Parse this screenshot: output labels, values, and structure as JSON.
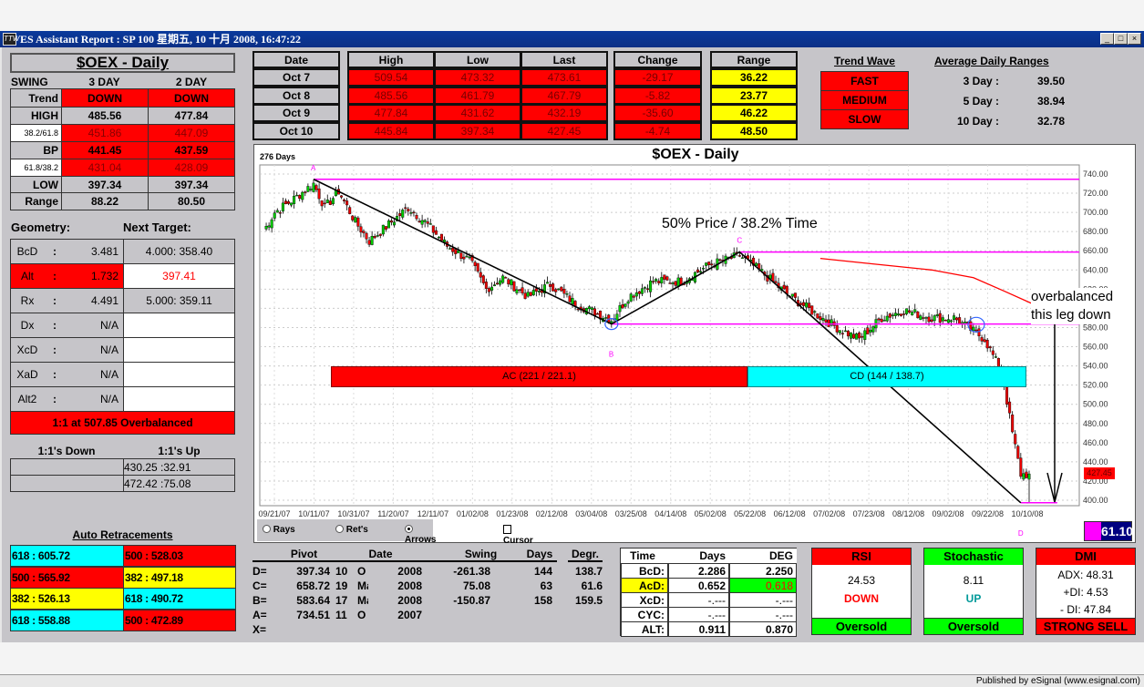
{
  "window": {
    "title": "ES Assistant Report : SP 100  星期五, 10 十月 2008, 16:47:22",
    "icon": "TTW",
    "controls": [
      "_",
      "□",
      "×"
    ]
  },
  "status_bar": "Published by eSignal (www.esignal.com)",
  "left": {
    "title": "$OEX - Daily",
    "swing_header": [
      "SWING",
      "3 DAY",
      "2 DAY"
    ],
    "swing_rows": [
      {
        "label": "Trend",
        "d3": "DOWN",
        "d2": "DOWN"
      },
      {
        "label": "HIGH",
        "d3": "485.56",
        "d2": "477.84"
      },
      {
        "label": "38.2/61.8",
        "d3": "451.86",
        "d2": "447.09"
      },
      {
        "label": "BP",
        "d3": "441.45",
        "d2": "437.59"
      },
      {
        "label": "61.8/38.2",
        "d3": "431.04",
        "d2": "428.09"
      },
      {
        "label": "LOW",
        "d3": "397.34",
        "d2": "397.34"
      },
      {
        "label": "Range",
        "d3": "88.22",
        "d2": "80.50"
      }
    ],
    "geometry_label": "Geometry:",
    "next_target_label": "Next Target:",
    "geometry": [
      {
        "name": "BcD",
        "sep": ":",
        "value": "3.481",
        "target": "4.000: 358.40"
      },
      {
        "name": "Alt",
        "sep": ":",
        "value": "1.732",
        "target": "397.41"
      },
      {
        "name": "Rx",
        "sep": ":",
        "value": "4.491",
        "target": "5.000: 359.11"
      },
      {
        "name": "Dx",
        "sep": ":",
        "value": "N/A",
        "target": ""
      },
      {
        "name": "XcD",
        "sep": ":",
        "value": "N/A",
        "target": ""
      },
      {
        "name": "XaD",
        "sep": ":",
        "value": "N/A",
        "target": ""
      },
      {
        "name": "Alt2",
        "sep": ":",
        "value": "N/A",
        "target": ""
      }
    ],
    "overbalanced": "1:1 at 507.85 Overbalanced",
    "ones_down_label": "1:1's Down",
    "ones_up_label": "1:1's Up",
    "ones": [
      {
        "down": "",
        "up": "430.25 :32.91"
      },
      {
        "down": "",
        "up": "472.42 :75.08"
      }
    ],
    "auto_retracements_label": "Auto Retracements",
    "retracements": [
      [
        {
          "text": "618 : 605.72",
          "color": "#00ffff"
        },
        {
          "text": "500 : 528.03",
          "color": "#ff0000"
        }
      ],
      [
        {
          "text": "500 : 565.92",
          "color": "#ff0000"
        },
        {
          "text": "382 : 497.18",
          "color": "#ffff00"
        }
      ],
      [
        {
          "text": "382 : 526.13",
          "color": "#ffff00"
        },
        {
          "text": "618 : 490.72",
          "color": "#00ffff"
        }
      ],
      [
        {
          "text": "618 : 558.88",
          "color": "#00ffff"
        },
        {
          "text": "500 : 472.89",
          "color": "#ff0000"
        }
      ]
    ]
  },
  "daily": {
    "headers": [
      "Date",
      "High",
      "Low",
      "Last",
      "Change",
      "Range"
    ],
    "rows": [
      {
        "date": "Oct 7",
        "high": "509.54",
        "low": "473.32",
        "last": "473.61",
        "change": "-29.17",
        "range": "36.22"
      },
      {
        "date": "Oct 8",
        "high": "485.56",
        "low": "461.79",
        "last": "467.79",
        "change": "-5.82",
        "range": "23.77"
      },
      {
        "date": "Oct 9",
        "high": "477.84",
        "low": "431.62",
        "last": "432.19",
        "change": "-35.60",
        "range": "46.22"
      },
      {
        "date": "Oct 10",
        "high": "445.84",
        "low": "397.34",
        "last": "427.45",
        "change": "-4.74",
        "range": "48.50"
      }
    ]
  },
  "trend_wave": {
    "title": "Trend Wave",
    "items": [
      "FAST",
      "MEDIUM",
      "SLOW"
    ]
  },
  "avg_ranges": {
    "title": "Average Daily Ranges",
    "items": [
      {
        "label": "3 Day :",
        "value": "39.50"
      },
      {
        "label": "5 Day :",
        "value": "38.94"
      },
      {
        "label": "10 Day :",
        "value": "32.78"
      }
    ]
  },
  "chart": {
    "title": "$OEX - Daily",
    "days_label": "276 Days",
    "annotation": "50% Price / 38.2% Time",
    "overbalanced_note": [
      "overbalanced",
      "this leg down"
    ],
    "ac_bar": "AC (221 / 221.1)",
    "cd_bar": "CD (144 / 138.7)",
    "last_price": "427.45",
    "readout": "61.10",
    "options": [
      {
        "label": "Rays",
        "type": "radio",
        "checked": false
      },
      {
        "label": "Ret's",
        "type": "radio",
        "checked": false
      },
      {
        "label": "Arrows",
        "type": "radio",
        "checked": true
      },
      {
        "label": "Cursor",
        "type": "checkbox",
        "checked": false
      }
    ]
  },
  "chart_data": {
    "type": "candlestick",
    "title": "$OEX - Daily",
    "ylim": [
      390,
      745
    ],
    "yticks": [
      "740.00",
      "720.00",
      "700.00",
      "680.00",
      "660.00",
      "640.00",
      "620.00",
      "600.00",
      "580.00",
      "560.00",
      "540.00",
      "520.00",
      "500.00",
      "480.00",
      "460.00",
      "440.00",
      "420.00",
      "400.00"
    ],
    "xticks": [
      "09/21/07",
      "10/11/07",
      "10/31/07",
      "11/20/07",
      "12/11/07",
      "01/02/08",
      "01/23/08",
      "02/12/08",
      "03/04/08",
      "03/25/08",
      "04/14/08",
      "05/02/08",
      "05/22/08",
      "06/12/08",
      "07/02/08",
      "07/23/08",
      "08/12/08",
      "09/02/08",
      "09/22/08",
      "10/10/08"
    ],
    "days": 276,
    "close_anchors": [
      [
        0,
        680
      ],
      [
        4,
        700
      ],
      [
        10,
        712
      ],
      [
        18,
        730
      ],
      [
        22,
        705
      ],
      [
        27,
        722
      ],
      [
        33,
        690
      ],
      [
        38,
        670
      ],
      [
        44,
        685
      ],
      [
        52,
        705
      ],
      [
        58,
        690
      ],
      [
        66,
        665
      ],
      [
        74,
        650
      ],
      [
        80,
        620
      ],
      [
        86,
        632
      ],
      [
        95,
        612
      ],
      [
        103,
        625
      ],
      [
        112,
        605
      ],
      [
        125,
        588
      ],
      [
        131,
        612
      ],
      [
        140,
        628
      ],
      [
        150,
        628
      ],
      [
        160,
        645
      ],
      [
        171,
        655
      ],
      [
        178,
        640
      ],
      [
        188,
        615
      ],
      [
        198,
        595
      ],
      [
        207,
        578
      ],
      [
        214,
        568
      ],
      [
        222,
        590
      ],
      [
        230,
        598
      ],
      [
        240,
        590
      ],
      [
        248,
        590
      ],
      [
        254,
        578
      ],
      [
        259,
        568
      ],
      [
        263,
        545
      ],
      [
        266,
        520
      ],
      [
        269,
        470
      ],
      [
        272,
        427
      ]
    ],
    "pivots": [
      {
        "label": "A",
        "day": 18,
        "price": 734.51
      },
      {
        "label": "B",
        "day": 125,
        "price": 583.64
      },
      {
        "label": "C",
        "day": 171,
        "price": 658.72
      },
      {
        "label": "D",
        "day": 272,
        "price": 397.34
      }
    ],
    "moving_average": [
      [
        200,
        652
      ],
      [
        220,
        646
      ],
      [
        240,
        640
      ],
      [
        255,
        632
      ],
      [
        266,
        618
      ],
      [
        276,
        605
      ]
    ]
  }
}
